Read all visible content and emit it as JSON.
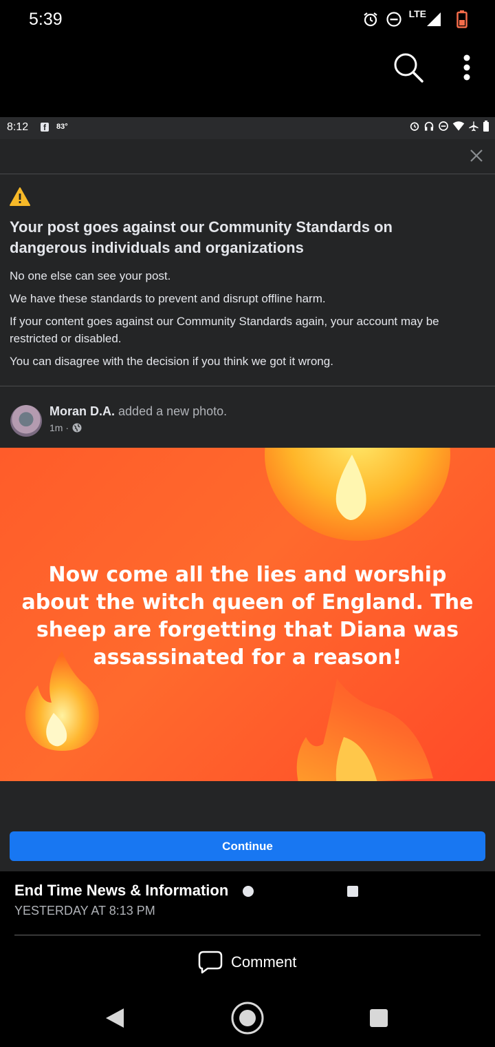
{
  "outer_status": {
    "time": "5:39",
    "network": "LTE"
  },
  "inner_status": {
    "time": "8:12",
    "temperature": "83°"
  },
  "notice": {
    "title": "Your post goes against our Community Standards on dangerous individuals and organizations",
    "lines": [
      "No one else can see your post.",
      "We have these standards to prevent and disrupt offline harm.",
      "If your content goes against our Community Standards again, your account may be restricted or disabled.",
      "You can disagree with the decision if you think we got it wrong."
    ]
  },
  "post": {
    "author": "Moran D.A.",
    "action": "added a new photo.",
    "time": "1m ·",
    "image_text": "Now come all the lies and worship about the witch queen of England. The sheep are forgetting that Diana was assassinated for a reason!"
  },
  "continue_label": "Continue",
  "shared": {
    "page_name": "End Time News & Information",
    "time": "YESTERDAY AT 8:13 PM",
    "comment_label": "Comment"
  },
  "colors": {
    "accent": "#1877f2",
    "panel": "#242526",
    "image_bg": "#ff5c2a"
  },
  "icons": [
    "alarm-icon",
    "do-not-disturb-icon",
    "signal-icon",
    "battery-icon",
    "search-icon",
    "more-vert-icon",
    "close-icon",
    "warning-icon",
    "globe-icon",
    "comment-icon",
    "back-icon",
    "home-icon",
    "recents-icon"
  ]
}
